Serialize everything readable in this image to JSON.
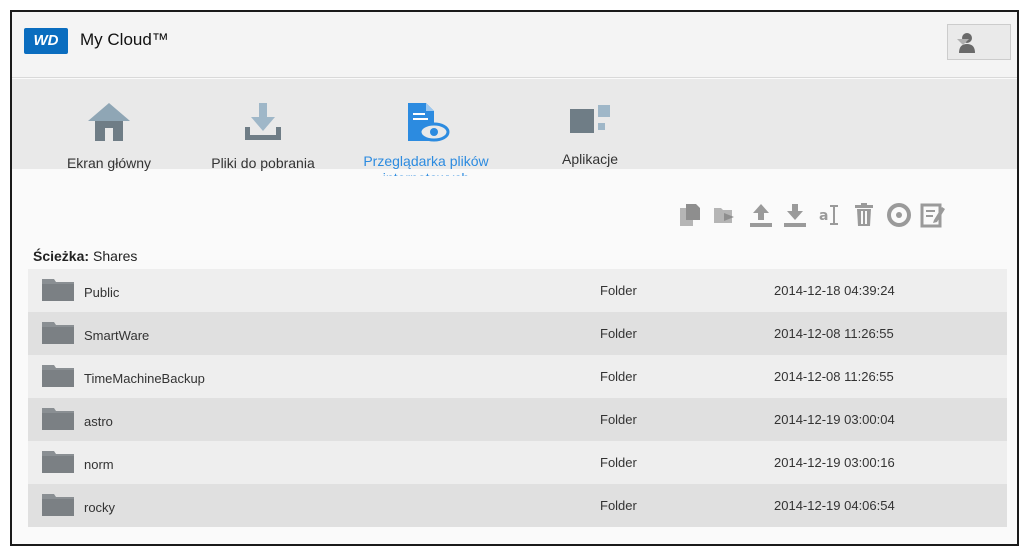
{
  "header": {
    "logo_text": "WD",
    "app_title": "My Cloud™"
  },
  "nav": {
    "items": [
      {
        "label": "Ekran główny",
        "icon": "home-icon"
      },
      {
        "label": "Pliki do pobrania",
        "icon": "download-icon"
      },
      {
        "label": "Przeglądarka plików",
        "label_line2": "internetowych",
        "icon": "web-file-viewer-icon",
        "active": true
      },
      {
        "label": "Aplikacje",
        "icon": "apps-icon"
      }
    ],
    "active_color": "#2c8be0"
  },
  "toolbar": {
    "icons": [
      "copy-icon",
      "move-icon",
      "upload-icon",
      "download-icon",
      "rename-icon",
      "delete-icon",
      "refresh-icon",
      "edit-icon"
    ]
  },
  "path": {
    "label": "Ścieżka:",
    "value": "Shares"
  },
  "files": [
    {
      "name": "Public",
      "type": "Folder",
      "date": "2014-12-18 04:39:24"
    },
    {
      "name": "SmartWare",
      "type": "Folder",
      "date": "2014-12-08 11:26:55"
    },
    {
      "name": "TimeMachineBackup",
      "type": "Folder",
      "date": "2014-12-08 11:26:55"
    },
    {
      "name": "astro",
      "type": "Folder",
      "date": "2014-12-19 03:00:04"
    },
    {
      "name": "norm",
      "type": "Folder",
      "date": "2014-12-19 03:00:16"
    },
    {
      "name": "rocky",
      "type": "Folder",
      "date": "2014-12-19 04:06:54"
    }
  ]
}
